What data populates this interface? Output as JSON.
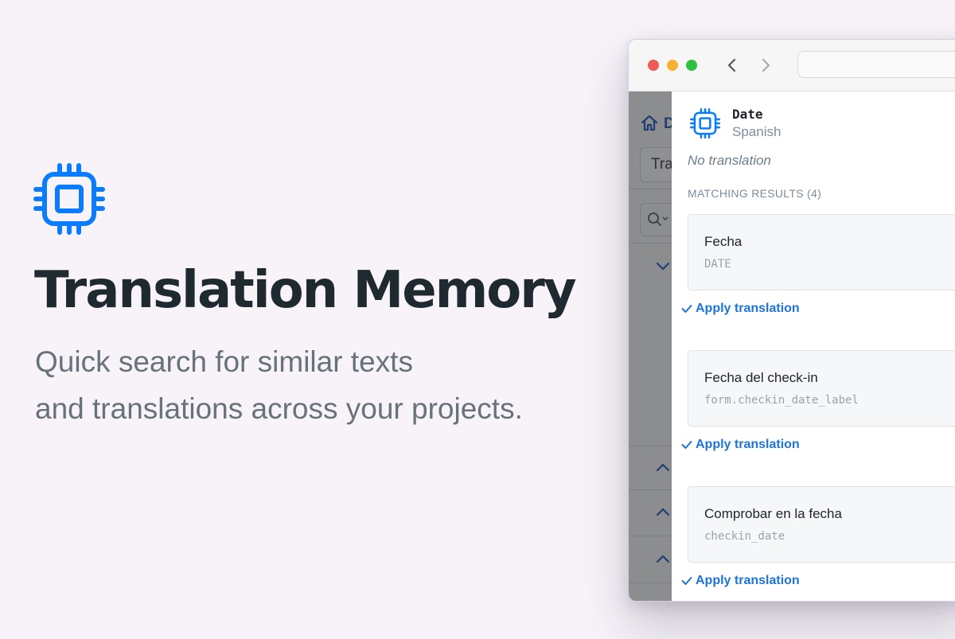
{
  "hero": {
    "icon": "chip-icon",
    "title": "Translation Memory",
    "subtitle_line1": "Quick search for similar texts",
    "subtitle_line2": "and translations across your projects."
  },
  "background_app": {
    "breadcrumb_initial": "D",
    "select_text": "Tra"
  },
  "panel": {
    "key": "Date",
    "language": "Spanish",
    "empty_state": "No translation",
    "results_heading": "MATCHING RESULTS (4)",
    "results": [
      {
        "text": "Fecha",
        "key": "DATE",
        "action": "Apply translation"
      },
      {
        "text": "Fecha del check-in",
        "key": "form.checkin_date_label",
        "action": "Apply translation"
      },
      {
        "text": "Comprobar en la fecha",
        "key": "checkin_date",
        "action": "Apply translation"
      }
    ]
  },
  "colors": {
    "accent": "#1b74d8",
    "icon_blue": "#0a7cff",
    "title": "#1f2a30",
    "subtitle": "#68727a",
    "background": "#f7f3f9"
  }
}
